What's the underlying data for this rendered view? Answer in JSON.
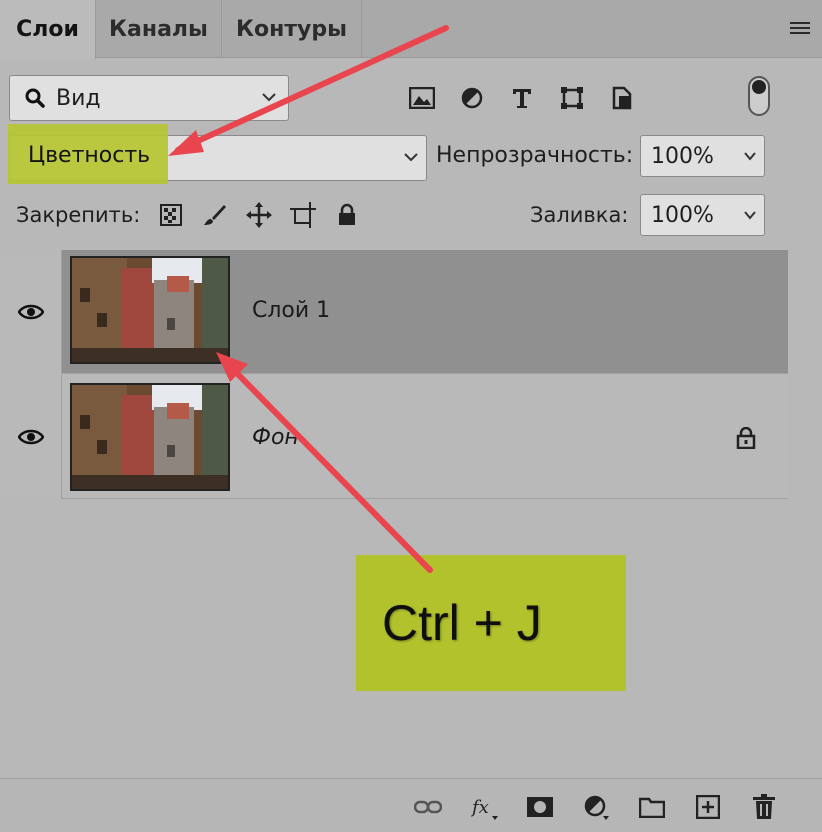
{
  "tabs": [
    {
      "label": "Слои",
      "active": true
    },
    {
      "label": "Каналы",
      "active": false
    },
    {
      "label": "Контуры",
      "active": false
    }
  ],
  "filter": {
    "label": "Вид",
    "icon": "search-icon"
  },
  "filter_icons": [
    "image-filter-icon",
    "adjustment-filter-icon",
    "type-filter-icon",
    "shape-filter-icon",
    "smart-object-filter-icon"
  ],
  "blend_mode": {
    "value": "Цветность"
  },
  "opacity": {
    "label": "Непрозрачность:",
    "value": "100%"
  },
  "lock": {
    "label": "Закрепить:",
    "icons": [
      "lock-transparent-pixels-icon",
      "lock-image-pixels-icon",
      "lock-position-icon",
      "lock-artboard-icon",
      "lock-all-icon"
    ]
  },
  "fill": {
    "label": "Заливка:",
    "value": "100%"
  },
  "layers": [
    {
      "name": "Слой 1",
      "selected": true,
      "locked": false,
      "italic": false
    },
    {
      "name": "Фон",
      "selected": false,
      "locked": true,
      "italic": true
    }
  ],
  "hint": {
    "text": "Ctrl + J"
  },
  "footer_icons": [
    "link-layers-icon",
    "fx-icon",
    "layer-mask-icon",
    "adjustment-layer-icon",
    "group-folder-icon",
    "new-layer-icon",
    "trash-icon"
  ],
  "colors": {
    "highlight": "#b5c630",
    "arrow": "#e8454f",
    "selected_row": "#909090"
  }
}
